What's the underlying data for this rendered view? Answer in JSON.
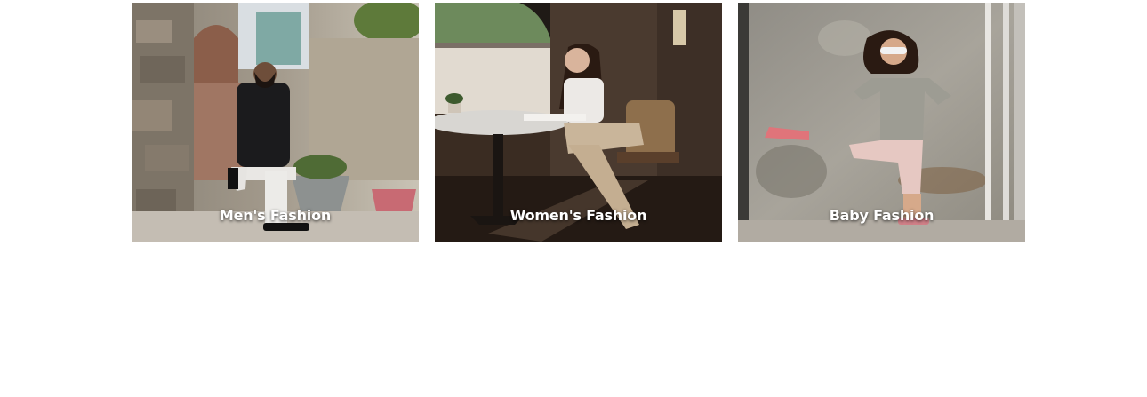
{
  "categories": [
    {
      "label": "Men's Fashion"
    },
    {
      "label": "Women's Fashion"
    },
    {
      "label": "Baby Fashion"
    }
  ]
}
